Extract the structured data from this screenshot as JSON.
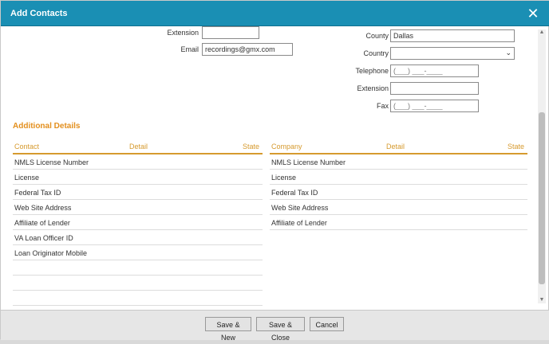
{
  "dialog": {
    "title": "Add Contacts"
  },
  "left_fields": {
    "extension": {
      "label": "Extension",
      "value": ""
    },
    "email": {
      "label": "Email",
      "value": "recordings@gmx.com"
    }
  },
  "right_fields": {
    "county": {
      "label": "County",
      "value": "Dallas"
    },
    "country": {
      "label": "Country",
      "value": ""
    },
    "telephone": {
      "label": "Telephone",
      "placeholder": "(___) ___-____"
    },
    "extension": {
      "label": "Extension",
      "value": ""
    },
    "fax": {
      "label": "Fax",
      "placeholder": "(___) ___-____"
    }
  },
  "additional_details": {
    "title": "Additional Details",
    "contact_table": {
      "headers": [
        "Contact",
        "Detail",
        "State"
      ],
      "rows": [
        "NMLS License Number",
        "License",
        "Federal Tax ID",
        "Web Site Address",
        "Affiliate of Lender",
        "VA Loan Officer ID",
        "Loan Originator Mobile",
        "",
        "",
        "",
        ""
      ]
    },
    "company_table": {
      "headers": [
        "Company",
        "Detail",
        "State"
      ],
      "rows": [
        "NMLS License Number",
        "License",
        "Federal Tax ID",
        "Web Site Address",
        "Affiliate of Lender"
      ]
    }
  },
  "footer": {
    "save_new": "Save & New",
    "save_close": "Save & Close",
    "cancel": "Cancel"
  }
}
